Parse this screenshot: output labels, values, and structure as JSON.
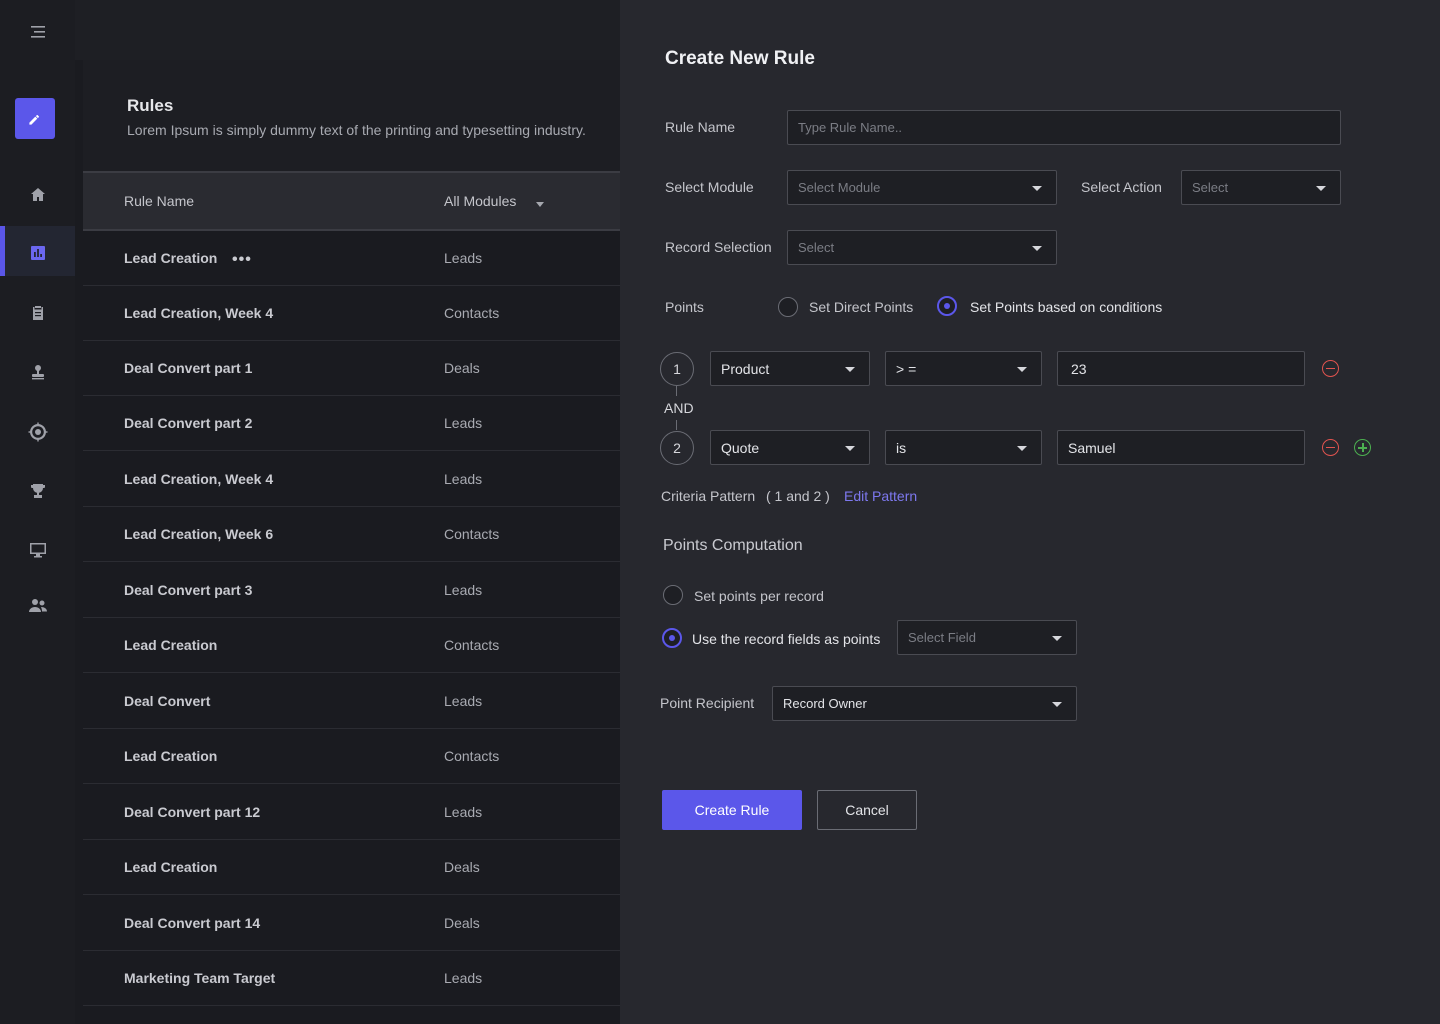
{
  "colors": {
    "accent": "#5b57ea",
    "link": "#7d78ee",
    "remove": "#e0534f",
    "add": "#4caf50",
    "drawer_bg": "#27282e",
    "sidebar_bg": "#1c1d22"
  },
  "sidebar": {
    "items": [
      {
        "icon": "menu-icon"
      },
      {
        "icon": "edit-icon",
        "active_button": true
      },
      {
        "icon": "home-icon"
      },
      {
        "icon": "bar-chart-icon",
        "active": true
      },
      {
        "icon": "clipboard-icon"
      },
      {
        "icon": "stamp-icon"
      },
      {
        "icon": "target-icon"
      },
      {
        "icon": "trophy-icon"
      },
      {
        "icon": "monitor-icon"
      },
      {
        "icon": "users-icon"
      }
    ]
  },
  "rules": {
    "title": "Rules",
    "subtitle": "Lorem Ipsum is simply dummy text of the printing and typesetting industry.",
    "columns": {
      "name": "Rule Name",
      "module": "All Modules"
    },
    "more_glyph": "•••",
    "rows": [
      {
        "name": "Lead Creation",
        "module": "Leads"
      },
      {
        "name": "Lead Creation, Week 4",
        "module": "Contacts"
      },
      {
        "name": "Deal Convert part 1",
        "module": "Deals"
      },
      {
        "name": "Deal Convert part 2",
        "module": "Leads"
      },
      {
        "name": "Lead Creation, Week 4",
        "module": "Leads"
      },
      {
        "name": "Lead Creation, Week 6",
        "module": "Contacts"
      },
      {
        "name": "Deal Convert part 3",
        "module": "Leads"
      },
      {
        "name": "Lead Creation",
        "module": "Contacts"
      },
      {
        "name": "Deal Convert",
        "module": "Leads"
      },
      {
        "name": "Lead Creation",
        "module": "Contacts"
      },
      {
        "name": "Deal Convert part 12",
        "module": "Leads"
      },
      {
        "name": "Lead Creation",
        "module": "Deals"
      },
      {
        "name": "Deal Convert part 14",
        "module": "Deals"
      },
      {
        "name": "Marketing Team Target",
        "module": "Leads"
      }
    ]
  },
  "drawer": {
    "title": "Create New Rule",
    "rule_name": {
      "label": "Rule Name",
      "placeholder": "Type Rule Name.."
    },
    "module": {
      "label": "Select Module",
      "value": "Select Module"
    },
    "action": {
      "label": "Select Action",
      "value": "Select"
    },
    "record_selection": {
      "label": "Record Selection",
      "value": "Select"
    },
    "points": {
      "label": "Points",
      "option_direct": "Set Direct Points",
      "option_conditions": "Set Points based on conditions",
      "selected": "conditions"
    },
    "conditions": [
      {
        "num": "1",
        "field": "Product",
        "operator": "> =",
        "value": "23"
      },
      {
        "num": "2",
        "field": "Quote",
        "operator": "is",
        "value": "Samuel"
      }
    ],
    "connector": "AND",
    "criteria": {
      "label": "Criteria Pattern",
      "pattern": "( 1 and 2 )",
      "edit_link": "Edit Pattern"
    },
    "computation": {
      "title": "Points Computation",
      "option_per_record": "Set points per record",
      "option_fields": "Use the record fields as points",
      "selected": "fields",
      "select_field": "Select Field"
    },
    "recipient": {
      "label": "Point Recipient",
      "value": "Record Owner"
    },
    "buttons": {
      "create": "Create Rule",
      "cancel": "Cancel"
    }
  }
}
